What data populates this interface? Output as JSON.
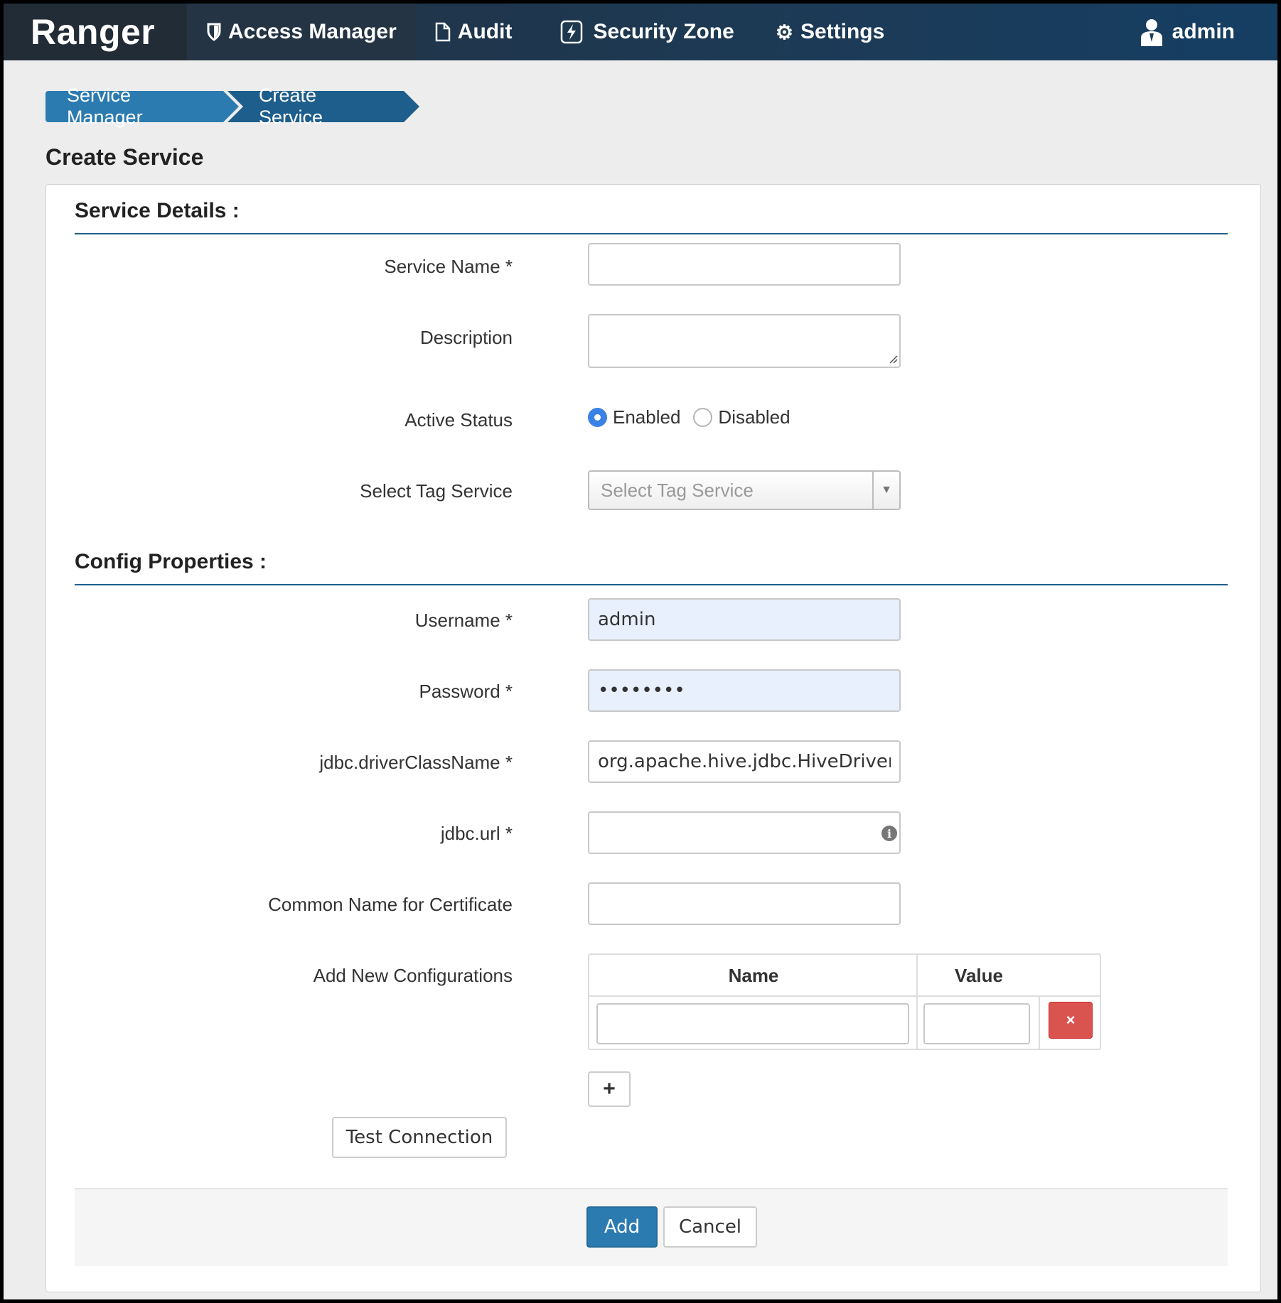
{
  "navbar": {
    "brand": "Ranger",
    "items": [
      {
        "label": "Access Manager",
        "icon": "shield-icon"
      },
      {
        "label": "Audit",
        "icon": "file-icon"
      },
      {
        "label": "Security Zone",
        "icon": "lightning-icon"
      },
      {
        "label": "Settings",
        "icon": "gear-icon"
      }
    ],
    "user": {
      "label": "admin",
      "icon": "user-icon"
    }
  },
  "breadcrumb": [
    "Service Manager",
    "Create Service"
  ],
  "page_title": "Create Service",
  "service_details": {
    "title": "Service Details :",
    "service_name_label": "Service Name *",
    "service_name_value": "",
    "description_label": "Description",
    "description_value": "",
    "active_status_label": "Active Status",
    "enabled_label": "Enabled",
    "disabled_label": "Disabled",
    "selected_status": "Enabled",
    "tag_service_label": "Select Tag Service",
    "tag_service_placeholder": "Select Tag Service"
  },
  "config_properties": {
    "title": "Config Properties :",
    "username_label": "Username *",
    "username_value": "admin",
    "password_label": "Password *",
    "password_value": "••••••••",
    "driver_label": "jdbc.driverClassName *",
    "driver_value": "org.apache.hive.jdbc.HiveDriver",
    "url_label": "jdbc.url *",
    "url_value": "",
    "cn_label": "Common Name for Certificate",
    "cn_value": "",
    "new_config_label": "Add New Configurations",
    "table_headers": {
      "name": "Name",
      "value": "Value"
    },
    "delete_symbol": "×",
    "add_symbol": "+"
  },
  "buttons": {
    "test_connection": "Test Connection",
    "add": "Add",
    "cancel": "Cancel"
  }
}
